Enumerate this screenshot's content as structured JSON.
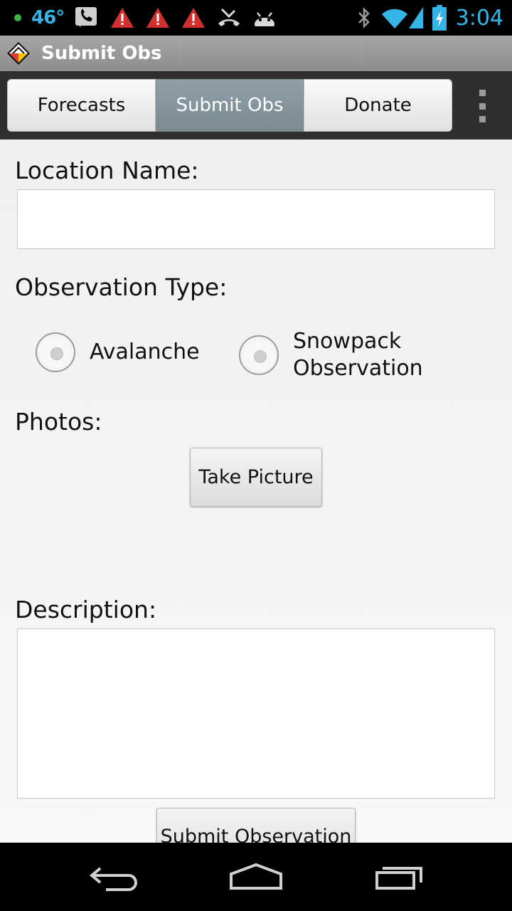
{
  "status_bar": {
    "temperature": "46°",
    "time": "3:04",
    "icons": [
      "notification-dot-icon",
      "voicemail-icon",
      "warning-icon",
      "warning-icon",
      "warning-icon",
      "missed-call-icon",
      "android-icon",
      "bluetooth-icon",
      "wifi-icon",
      "signal-icon",
      "battery-charging-icon"
    ]
  },
  "action_bar": {
    "title": "Submit Obs",
    "logo": "avalanche-logo-icon"
  },
  "tabs": [
    {
      "label": "Forecasts",
      "selected": false
    },
    {
      "label": "Submit Obs",
      "selected": true
    },
    {
      "label": "Donate",
      "selected": false
    }
  ],
  "form": {
    "location_label": "Location Name:",
    "location_value": "",
    "observation_type_label": "Observation Type:",
    "options": [
      {
        "label": "Avalanche",
        "checked": false
      },
      {
        "label_line1": "Snowpack",
        "label_line2": "Observation",
        "checked": false
      }
    ],
    "photos_label": "Photos:",
    "take_picture_label": "Take Picture",
    "description_label": "Description:",
    "description_value": "",
    "submit_label": "Submit Observation"
  },
  "nav_bar": {
    "icons": [
      "back-icon",
      "home-icon",
      "recent-apps-icon"
    ]
  },
  "colors": {
    "status_accent": "#33b5e5",
    "selected_tab": "#8595a0",
    "background": "#f2f2f2"
  }
}
